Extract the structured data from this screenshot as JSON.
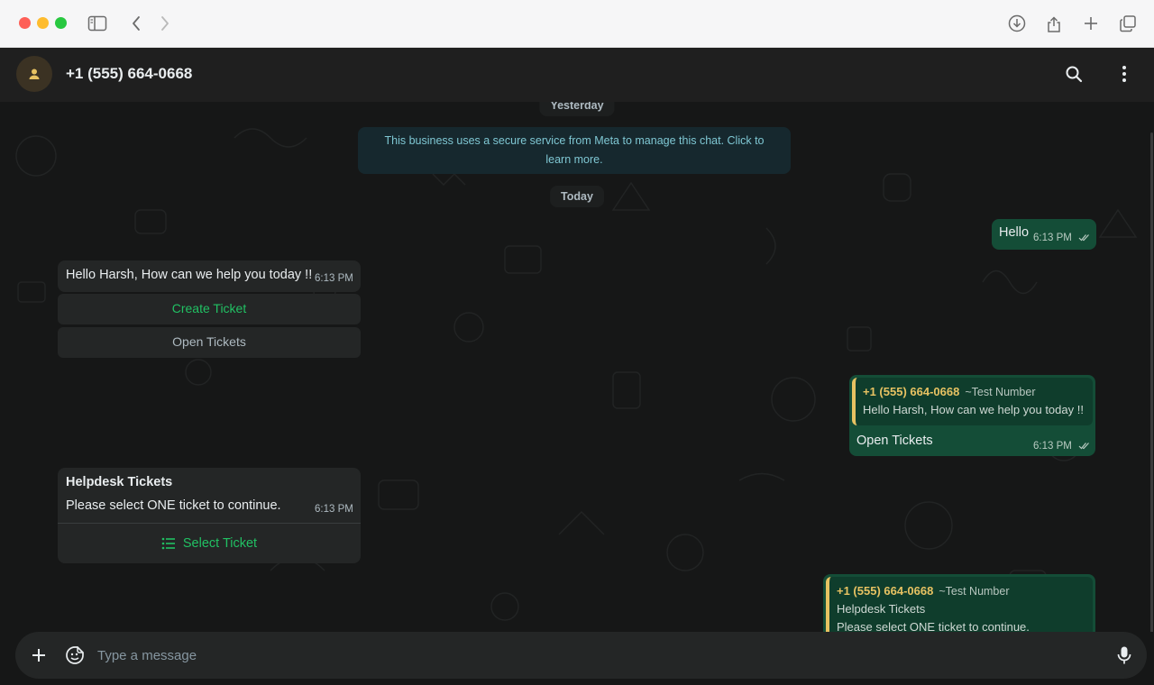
{
  "browser": {
    "icons": [
      "sidebar-toggle-icon",
      "back-icon",
      "forward-icon",
      "download-icon",
      "share-icon",
      "new-tab-icon",
      "tabs-overview-icon"
    ]
  },
  "header": {
    "contact": "+1 (555) 664-0668",
    "icons": [
      "search-icon",
      "more-vertical-icon"
    ]
  },
  "chat": {
    "date_yesterday": "Yesterday",
    "meta_notice": "This business uses a secure service from Meta to manage this chat. Click to learn more.",
    "date_today": "Today",
    "msg_hello": {
      "text": "Hello",
      "time": "6:13 PM"
    },
    "msg_greet": {
      "text": "Hello Harsh, How can we help you today !!",
      "time": "6:13 PM",
      "btn_create": "Create Ticket",
      "btn_open": "Open Tickets"
    },
    "msg_reply_open": {
      "quote_name": "+1 (555) 664-0668",
      "quote_alias": "~Test Number",
      "quote_text": "Hello Harsh, How can we help you today !!",
      "text": "Open Tickets",
      "time": "6:13 PM"
    },
    "msg_helpdesk": {
      "title": "Helpdesk Tickets",
      "body": "Please select ONE ticket to continue.",
      "time": "6:13 PM",
      "action": "Select Ticket"
    },
    "msg_reply_helpdesk": {
      "quote_name": "+1 (555) 664-0668",
      "quote_alias": "~Test Number",
      "quote_line1": "Helpdesk Tickets",
      "quote_line2": "Please select ONE ticket to continue."
    }
  },
  "composer": {
    "placeholder": "Type a message"
  },
  "colors": {
    "accent_green": "#21c063",
    "outgoing_bubble": "#144d37",
    "quote_accent": "#e7c262"
  }
}
